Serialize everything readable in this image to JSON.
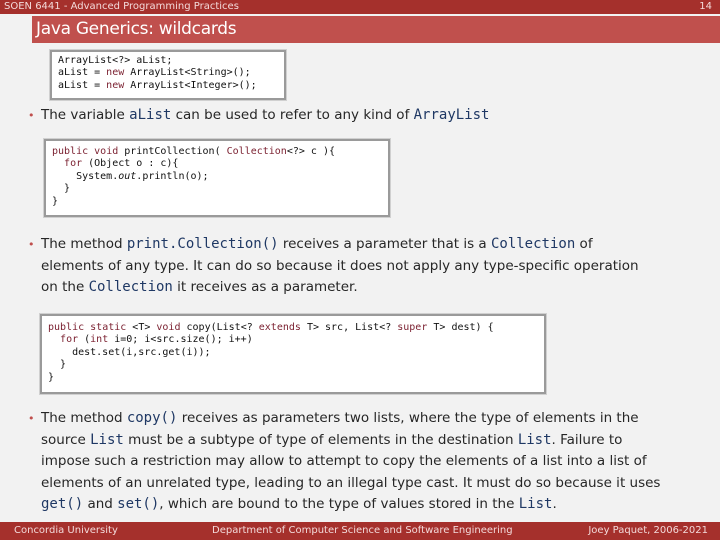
{
  "header": {
    "course": "SOEN 6441 - Advanced Programming Practices",
    "page_number": "14"
  },
  "slide": {
    "title": "Java Generics: wildcards"
  },
  "code1": {
    "line1": "ArrayList<?> aList;",
    "line2a": "aList = ",
    "line2b": "new",
    "line2c": " ArrayList<String>();",
    "line3a": "aList = ",
    "line3b": "new",
    "line3c": " ArrayList<Integer>();"
  },
  "bullet1": {
    "t1": "The variable ",
    "m1": "aList",
    "t2": " can be used to refer to any kind of ",
    "m2": "ArrayList"
  },
  "code2": {
    "l1a": "public",
    "l1b": " ",
    "l1c": "void",
    "l1d": " printCollection( ",
    "l1e": "Collection",
    "l1f": "<?> c ){",
    "l2a": "  ",
    "l2b": "for",
    "l2c": " (Object o : c){",
    "l3a": "    System.",
    "l3b": "out",
    "l3c": ".println(o);",
    "l4": "  }",
    "l5": "}"
  },
  "bullet2": {
    "t1": "The method ",
    "m1": "print.Collection()",
    "t2": " receives a parameter that is a ",
    "m2": "Collection",
    "t3": " of",
    "line2": "elements of any type. It can do so because it does not apply any type-specific operation",
    "t4": "on the ",
    "m3": "Collection",
    "t5": " it receives as a parameter."
  },
  "code3": {
    "l1a": "public",
    "l1b": " ",
    "l1c": "static",
    "l1d": " <T> ",
    "l1e": "void",
    "l1f": " copy(List<? ",
    "l1g": "extends",
    "l1h": " T> src, List<? ",
    "l1i": "super",
    "l1j": " T> dest) {",
    "l2a": "  ",
    "l2b": "for",
    "l2c": " (",
    "l2d": "int",
    "l2e": " i=0; i<src.size(); i++)",
    "l3": "    dest.set(i,src.get(i));",
    "l4": "  }",
    "l5": "}"
  },
  "bullet3": {
    "t1": "The method ",
    "m1": "copy()",
    "t2": " receives as parameters two lists, where the type of elements in the",
    "t3": "source ",
    "m2": "List",
    "t4": " must be a subtype of type of elements in the destination ",
    "m3": "List",
    "t5": ". Failure to",
    "line3": "impose such a restriction may allow to attempt to copy the elements of a list into a list of",
    "line4": "elements of an unrelated type, leading to an illegal type cast. It must do so because it uses",
    "m4": "get()",
    "t6": " and ",
    "m5": "set()",
    "t7": ", which are bound to the type of values stored in the ",
    "m6": "List",
    "t8": "."
  },
  "footer": {
    "left": "Concordia University",
    "center": "Department of Computer Science and Software Engineering",
    "right": "Joey Paquet, 2006-2021"
  }
}
